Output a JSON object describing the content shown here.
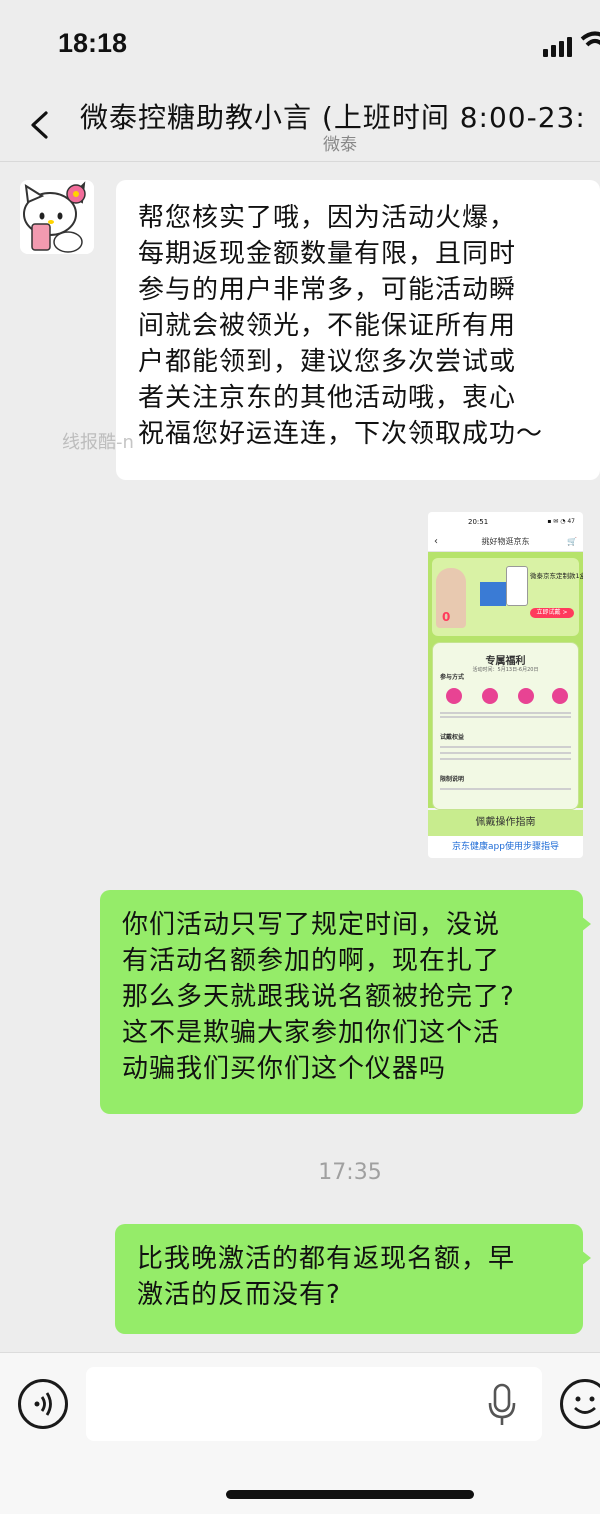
{
  "status_bar": {
    "time": "18:18"
  },
  "header": {
    "title": "微泰控糖助教小言 (上班时间 8:00-23:",
    "subtitle": "微泰"
  },
  "messages": [
    {
      "direction": "incoming",
      "lines": [
        "帮您核实了哦，因为活动火爆，",
        "每期返现金额数量有限，且同时",
        "参与的用户非常多，可能活动瞬",
        "间就会被领光，不能保证所有用",
        "户都能领到，建议您多次尝试或",
        "者关注京东的其他活动哦，衷心",
        "祝福您好运连连，下次领取成功～"
      ]
    },
    {
      "direction": "outgoing",
      "lines": [
        "你们活动只写了规定时间，没说",
        "有活动名额参加的啊，现在扎了",
        "那么多天就跟我说名额被抢完了?",
        "这不是欺骗大家参加你们这个活",
        "动骗我们买你们这个仪器吗"
      ]
    },
    {
      "direction": "outgoing",
      "lines": [
        "比我晚激活的都有返现名额，早",
        "激活的反而没有?"
      ]
    }
  ],
  "timestamp": "17:35",
  "watermark": "线报酷-n",
  "shared_image": {
    "status_time": "20:51",
    "status_icons": "▪ ✉ ◔ 47",
    "nav_title": "挑好物逛京东",
    "banner_title": "微泰京东定制款1盒装",
    "trial_button": "立即试戴 >",
    "price_zero": "0",
    "card_title": "专属福利",
    "card_subtitle": "活动时间：5月13日-6月20日",
    "section_join": "参与方式",
    "section_benefit": "试戴权益",
    "section_limit": "限制说明",
    "guide": "佩戴操作指南",
    "footer_link": "京东健康app使用步骤指导"
  },
  "input": {
    "value": "",
    "placeholder": ""
  },
  "icons": {
    "back": "chevron-left-icon",
    "voice": "voice-icon",
    "mic": "microphone-icon",
    "emoji": "emoji-icon"
  },
  "colors": {
    "outgoing_bubble": "#95ec69",
    "incoming_bubble": "#ffffff",
    "background": "#ededed"
  }
}
